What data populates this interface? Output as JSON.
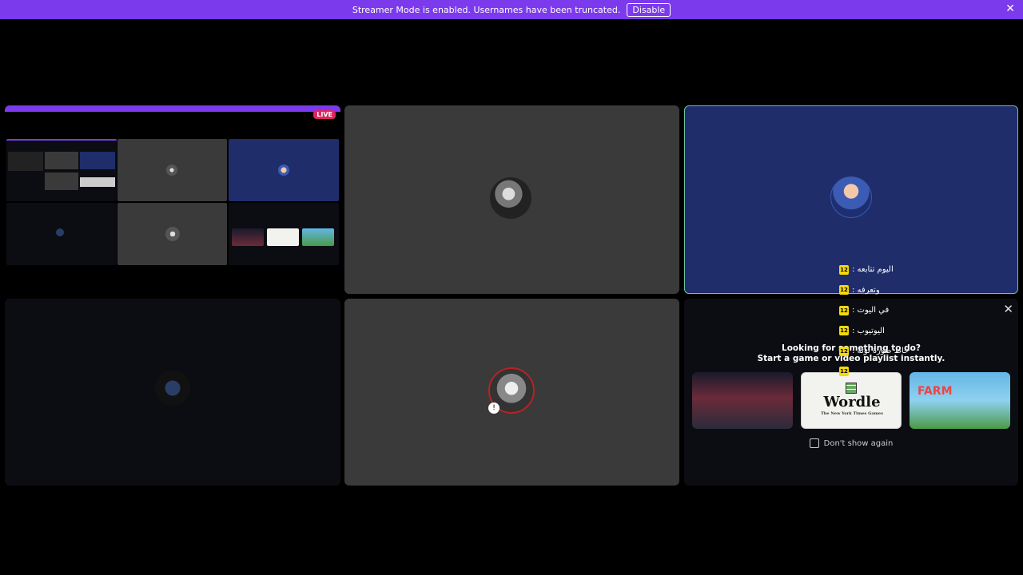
{
  "banner": {
    "message": "Streamer Mode is enabled. Usernames have been truncated.",
    "disable_label": "Disable",
    "close_glyph": "✕"
  },
  "screenshare": {
    "live_label": "LIVE"
  },
  "overlay_list": [
    {
      "badge": "12",
      "text": "اليوم تتابعه :"
    },
    {
      "badge": "12",
      "text": "وتعرفه :"
    },
    {
      "badge": "12",
      "text": "في اليوت :"
    },
    {
      "badge": "12",
      "text": "اليوتيوب :"
    },
    {
      "badge": "12",
      "text": "حاط صورة توته :"
    },
    {
      "badge": "12",
      "text": ""
    }
  ],
  "activity": {
    "close_glyph": "✕",
    "title": "Looking for something to do?",
    "subtitle": "Start a game or video playlist instantly.",
    "cards": [
      {
        "name": "",
        "icon": "storefront-image"
      },
      {
        "name": "Wordle",
        "sub": "The New York Times Games"
      },
      {
        "name": "FARM",
        "icon": "farm-valley-image"
      }
    ],
    "dont_show_label": "Don't show again"
  },
  "colors": {
    "banner": "#7c3aed",
    "accent_green": "#6bc59b",
    "live": "#e0245e",
    "badge_yellow": "#f5d90a"
  }
}
